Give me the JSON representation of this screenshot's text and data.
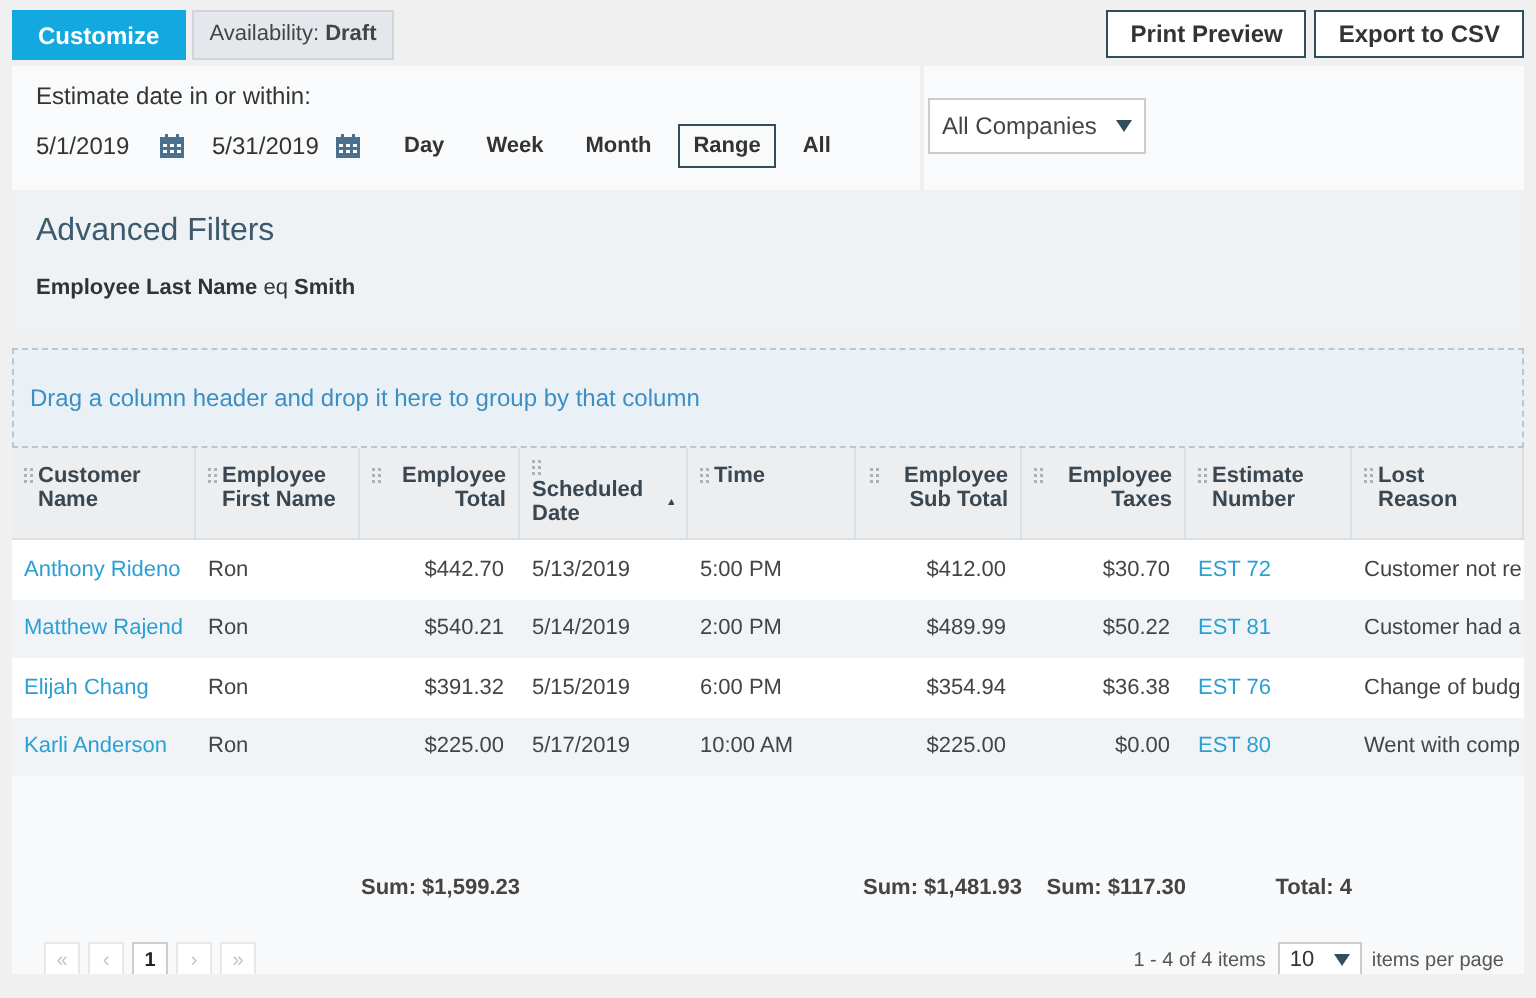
{
  "toolbar": {
    "customize": "Customize",
    "availability": "Availability: **Draft**",
    "actions": [
      "Print Preview",
      "Export to CSV"
    ]
  },
  "date_filter": {
    "label": "Estimate date in or within:",
    "start": "5/1/2019",
    "end": "5/31/2019",
    "periods": [
      {
        "label": "Day",
        "selected": false
      },
      {
        "label": "Week",
        "selected": false
      },
      {
        "label": "Month",
        "selected": false
      },
      {
        "label": "Range",
        "selected": true
      },
      {
        "label": "All",
        "selected": false
      }
    ]
  },
  "company_select": {
    "value": "All Companies"
  },
  "advanced_filters": {
    "title": "Advanced Filters",
    "expression": "**Employee Last Name** eq **Smith**"
  },
  "group_hint": "Drag a column header and drop it here to group by that column",
  "table": {
    "columns": [
      {
        "label": "Customer Name",
        "kind": "link",
        "sorted_ascending": false
      },
      {
        "label": "Employee First Name",
        "kind": "text",
        "sorted_ascending": false
      },
      {
        "label": "Employee Total",
        "kind": "number",
        "sorted_ascending": false,
        "footer": "Sum: $1,599.23"
      },
      {
        "label": "Scheduled Date",
        "kind": "text",
        "sorted_ascending": true
      },
      {
        "label": "Time",
        "kind": "text",
        "sorted_ascending": false
      },
      {
        "label": "Employee Sub Total",
        "kind": "number",
        "sorted_ascending": false,
        "footer": "Sum: $1,481.93"
      },
      {
        "label": "Employee Taxes",
        "kind": "number",
        "sorted_ascending": false,
        "footer": "Sum: $117.30"
      },
      {
        "label": "Estimate Number",
        "kind": "link",
        "sorted_ascending": false,
        "footer": "Total: 4"
      },
      {
        "label": "Lost Reason",
        "kind": "text",
        "sorted_ascending": false
      }
    ],
    "rows": [
      [
        "Anthony Rideno",
        "Ron",
        "$442.70",
        "5/13/2019",
        "5:00 PM",
        "$412.00",
        "$30.70",
        "EST 72",
        "Customer not re"
      ],
      [
        "Matthew Rajend",
        "Ron",
        "$540.21",
        "5/14/2019",
        "2:00 PM",
        "$489.99",
        "$50.22",
        "EST 81",
        "Customer had a"
      ],
      [
        "Elijah Chang",
        "Ron",
        "$391.32",
        "5/15/2019",
        "6:00 PM",
        "$354.94",
        "$36.38",
        "EST 76",
        "Change of budg"
      ],
      [
        "Karli Anderson",
        "Ron",
        "$225.00",
        "5/17/2019",
        "10:00 AM",
        "$225.00",
        "$0.00",
        "EST 80",
        "Went with comp"
      ]
    ]
  },
  "pager": {
    "buttons": [
      {
        "label": "«",
        "disabled": true,
        "selected": false
      },
      {
        "label": "‹",
        "disabled": true,
        "selected": false
      },
      {
        "label": "1",
        "disabled": false,
        "selected": true
      },
      {
        "label": "›",
        "disabled": true,
        "selected": false
      },
      {
        "label": "»",
        "disabled": true,
        "selected": false
      }
    ],
    "info": "1 - 4 of 4 items",
    "page_size": "10",
    "page_size_label": "items per page"
  }
}
